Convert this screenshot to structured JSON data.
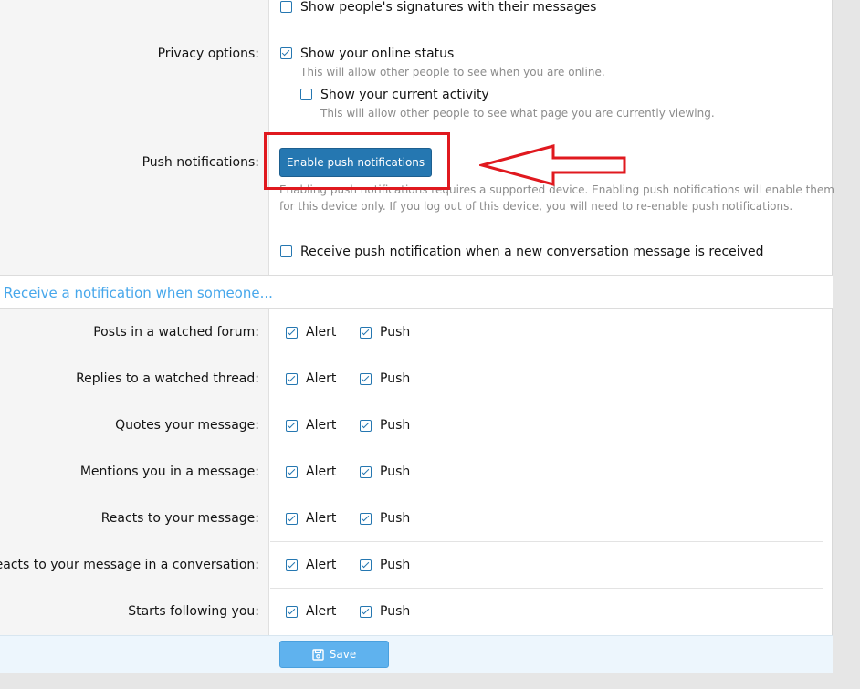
{
  "top": {
    "signatures_label": "Show people's signatures with their messages"
  },
  "privacy": {
    "label": "Privacy options:",
    "online_status": {
      "label": "Show your online status",
      "hint": "This will allow other people to see when you are online.",
      "checked": true
    },
    "current_activity": {
      "label": "Show your current activity",
      "hint": "This will allow other people to see what page you are currently viewing.",
      "checked": false
    }
  },
  "push": {
    "label": "Push notifications:",
    "button_label": "Enable push notifications",
    "hint_line1": "Enabling push notifications requires a supported device. Enabling push notifications will enable them",
    "hint_line2": "for this device only. If you log out of this device, you will need to re-enable push notifications.",
    "conversation_label": "Receive push notification when a new conversation message is received"
  },
  "annotation": {
    "highlight_color": "#e0191f"
  },
  "notify": {
    "heading": "Receive a notification when someone...",
    "alert_label": "Alert",
    "push_label": "Push",
    "rows": [
      {
        "label": "Posts in a watched forum:"
      },
      {
        "label": "Replies to a watched thread:"
      },
      {
        "label": "Quotes your message:"
      },
      {
        "label": "Mentions you in a message:"
      },
      {
        "label": "Reacts to your message:"
      },
      {
        "label": "Reacts to your message in a conversation:"
      },
      {
        "label": "Starts following you:"
      }
    ]
  },
  "footer": {
    "save_label": "Save",
    "save_icon": "save-icon"
  },
  "colors": {
    "accent": "#2577b1",
    "link": "#47a7eb",
    "save": "#5fb2ee"
  }
}
